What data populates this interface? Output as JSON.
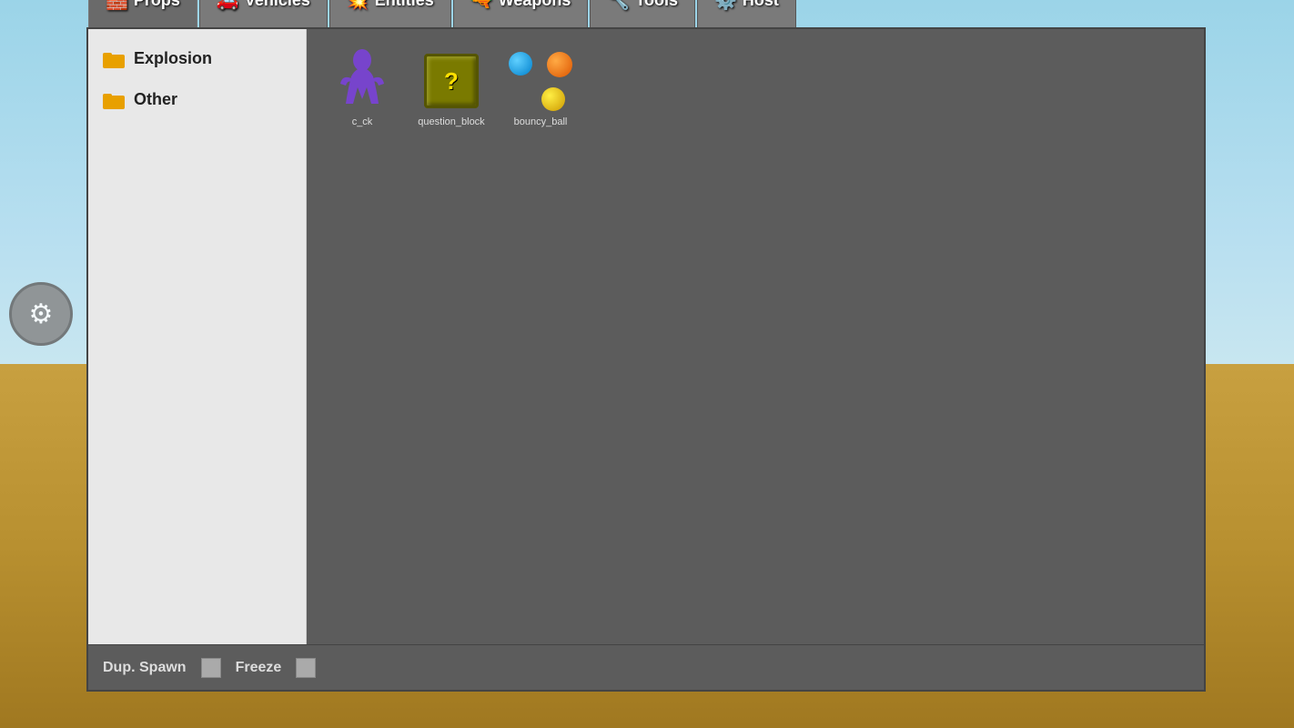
{
  "background": {
    "sky_color": "#9bd4e8",
    "ground_color": "#c8a040"
  },
  "tabs": [
    {
      "id": "props",
      "label": "Props",
      "icon": "🧱",
      "active": true
    },
    {
      "id": "vehicles",
      "label": "Vehicles",
      "icon": "🚗",
      "active": false
    },
    {
      "id": "entities",
      "label": "Entities",
      "icon": "💥",
      "active": false
    },
    {
      "id": "weapons",
      "label": "Weapons",
      "icon": "🔫",
      "active": false
    },
    {
      "id": "tools",
      "label": "Tools",
      "icon": "🔧",
      "active": false
    },
    {
      "id": "host",
      "label": "Host",
      "icon": "⚙️",
      "active": false
    }
  ],
  "sidebar": {
    "items": [
      {
        "id": "explosion",
        "label": "Explosion",
        "icon": "folder"
      },
      {
        "id": "other",
        "label": "Other",
        "icon": "folder"
      }
    ]
  },
  "grid_items": [
    {
      "id": "c_ck",
      "label": "c_ck",
      "type": "purple_figure"
    },
    {
      "id": "question_block",
      "label": "question_block",
      "type": "question_block"
    },
    {
      "id": "bouncy_ball",
      "label": "bouncy_ball",
      "type": "bouncy_ball"
    }
  ],
  "bottom_bar": {
    "dup_spawn_label": "Dup. Spawn",
    "freeze_label": "Freeze"
  },
  "wrench_icon": "⚙"
}
